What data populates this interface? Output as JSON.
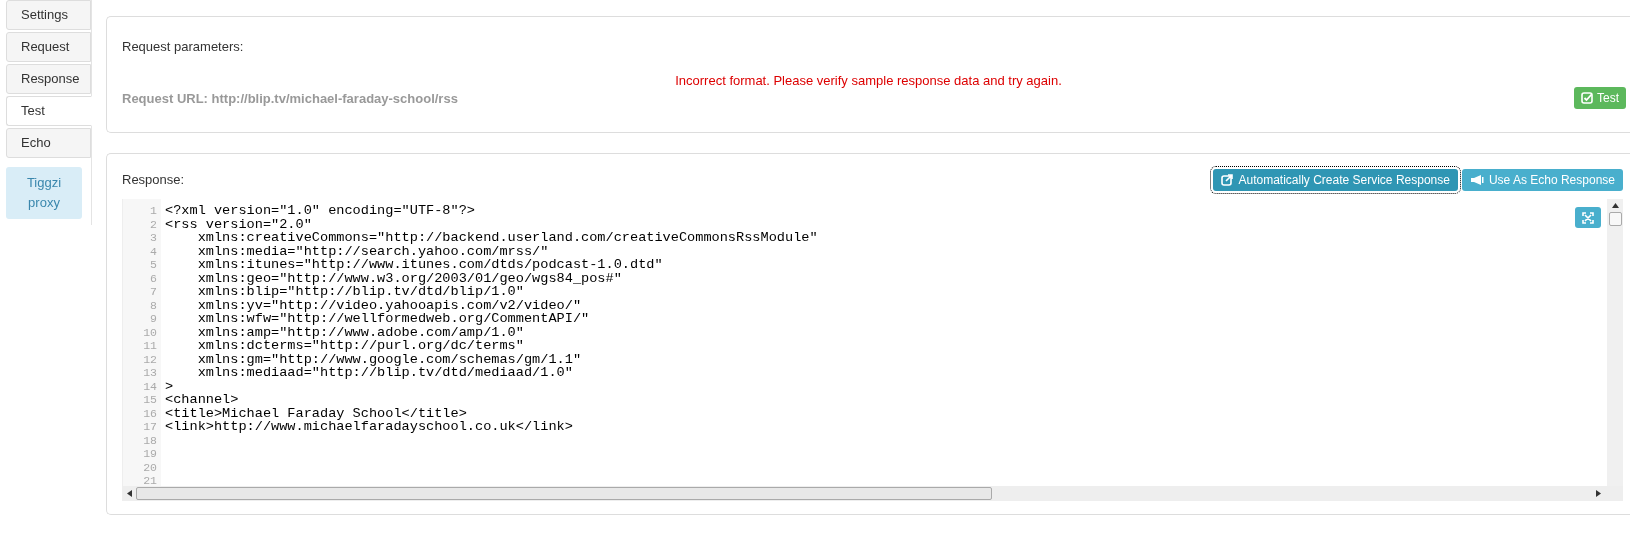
{
  "tabs": [
    {
      "label": "Settings",
      "selected": false
    },
    {
      "label": "Request",
      "selected": false
    },
    {
      "label": "Response",
      "selected": false
    },
    {
      "label": "Test",
      "selected": true
    },
    {
      "label": "Echo",
      "selected": false
    }
  ],
  "proxy_button": {
    "label": "Tiggzi proxy"
  },
  "request_panel": {
    "title": "Request parameters:",
    "error": "Incorrect format. Please verify sample response data and try again.",
    "request_url": "Request URL: http://blip.tv/michael-faraday-school/rss",
    "test_button": "Test"
  },
  "response_panel": {
    "title": "Response:",
    "buttons": [
      {
        "label": "Automatically Create Service Response",
        "focused": true
      },
      {
        "label": "Use As Echo Response",
        "focused": false
      }
    ],
    "code_lines": [
      {
        "number": "1",
        "text": "<?xml version=\"1.0\" encoding=\"UTF-8\"?>"
      },
      {
        "number": "2",
        "text": "<rss version=\"2.0\""
      },
      {
        "number": "3",
        "text": "    xmlns:creativeCommons=\"http://backend.userland.com/creativeCommonsRssModule\""
      },
      {
        "number": "4",
        "text": "    xmlns:media=\"http://search.yahoo.com/mrss/\""
      },
      {
        "number": "5",
        "text": "    xmlns:itunes=\"http://www.itunes.com/dtds/podcast-1.0.dtd\""
      },
      {
        "number": "6",
        "text": "    xmlns:geo=\"http://www.w3.org/2003/01/geo/wgs84_pos#\""
      },
      {
        "number": "7",
        "text": "    xmlns:blip=\"http://blip.tv/dtd/blip/1.0\""
      },
      {
        "number": "8",
        "text": "    xmlns:yv=\"http://video.yahooapis.com/v2/video/\""
      },
      {
        "number": "9",
        "text": "    xmlns:wfw=\"http://wellformedweb.org/CommentAPI/\""
      },
      {
        "number": "10",
        "text": "    xmlns:amp=\"http://www.adobe.com/amp/1.0\""
      },
      {
        "number": "11",
        "text": "    xmlns:dcterms=\"http://purl.org/dc/terms\""
      },
      {
        "number": "12",
        "text": "    xmlns:gm=\"http://www.google.com/schemas/gm/1.1\""
      },
      {
        "number": "13",
        "text": "    xmlns:mediaad=\"http://blip.tv/dtd/mediaad/1.0\""
      },
      {
        "number": "14",
        "text": ">"
      },
      {
        "number": "15",
        "text": "<channel>"
      },
      {
        "number": "16",
        "text": "<title>Michael Faraday School</title>"
      },
      {
        "number": "17",
        "text": "<link>http://www.michaelfaradayschool.co.uk</link>"
      },
      {
        "number": "18"
      },
      {
        "number": "19"
      },
      {
        "number": "20"
      },
      {
        "number": "21"
      }
    ]
  }
}
